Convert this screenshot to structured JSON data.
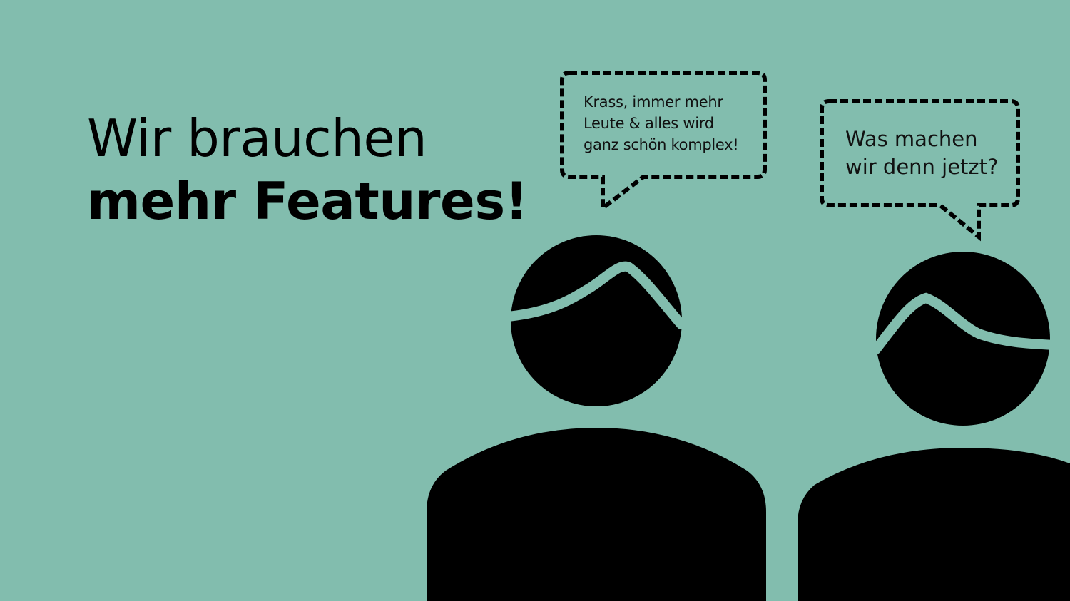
{
  "headline": {
    "line1": "Wir brauchen",
    "line2": "mehr Features!"
  },
  "bubbles": {
    "left": "Krass, immer mehr\nLeute & alles wird\nganz schön komplex!",
    "right": "Was machen\nwir denn jetzt?"
  },
  "colors": {
    "background": "#82bdae",
    "figure": "#000000"
  }
}
